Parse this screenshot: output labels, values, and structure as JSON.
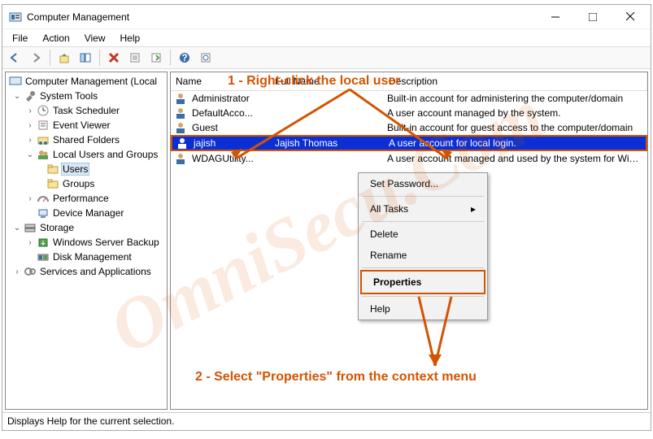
{
  "window": {
    "title": "Computer Management"
  },
  "menu": {
    "file": "File",
    "action": "Action",
    "view": "View",
    "help": "Help"
  },
  "tree": {
    "root": "Computer Management (Local",
    "system_tools": "System Tools",
    "task_scheduler": "Task Scheduler",
    "event_viewer": "Event Viewer",
    "shared_folders": "Shared Folders",
    "local_users": "Local Users and Groups",
    "users": "Users",
    "groups": "Groups",
    "performance": "Performance",
    "device_manager": "Device Manager",
    "storage": "Storage",
    "wsb": "Windows Server Backup",
    "disk_mgmt": "Disk Management",
    "services": "Services and Applications"
  },
  "columns": {
    "name": "Name",
    "fullname": "Full Name",
    "description": "Description"
  },
  "users": [
    {
      "name": "Administrator",
      "full": "",
      "desc": "Built-in account for administering the computer/domain"
    },
    {
      "name": "DefaultAcco...",
      "full": "",
      "desc": "A user account managed by the system."
    },
    {
      "name": "Guest",
      "full": "",
      "desc": "Built-in account for guest access to the computer/domain"
    },
    {
      "name": "jajish",
      "full": "Jajish Thomas",
      "desc": "A user account for local login."
    },
    {
      "name": "WDAGUtility...",
      "full": "",
      "desc": "A user account managed and used by the system for Windows"
    }
  ],
  "context": {
    "set_password": "Set Password...",
    "all_tasks": "All Tasks",
    "delete": "Delete",
    "rename": "Rename",
    "properties": "Properties",
    "help": "Help"
  },
  "status": "Displays Help for the current selection.",
  "annotations": {
    "a1": "1 - Right-click the local user",
    "a2": "2 - Select \"Properties\" from the context menu"
  },
  "watermark": "OmniSecu.Com"
}
